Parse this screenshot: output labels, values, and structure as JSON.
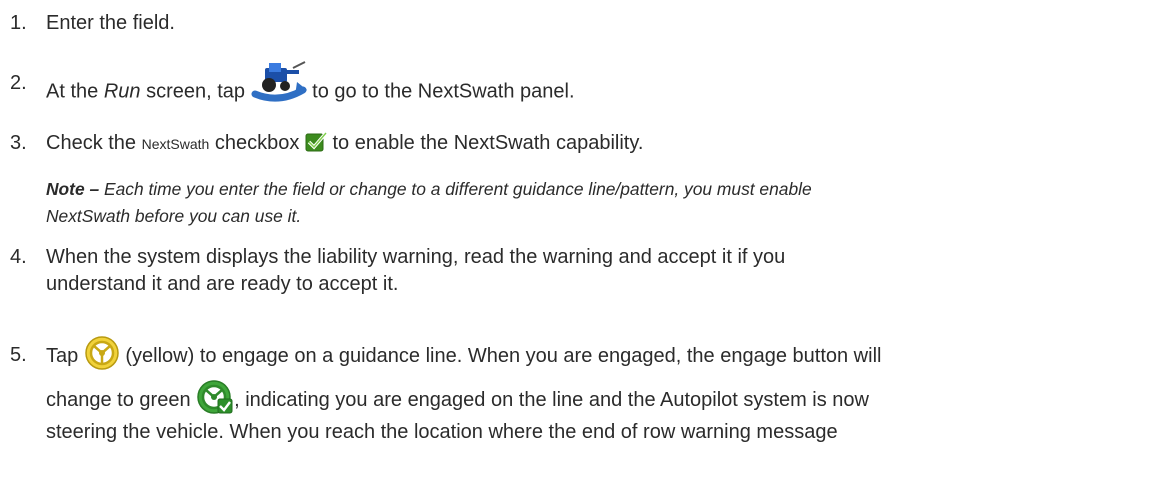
{
  "steps": [
    {
      "num": "1.",
      "text": "Enter the field."
    },
    {
      "num": "2.",
      "pre": "At the ",
      "screen": "Run",
      "mid": " screen, tap ",
      "post": " to go to the NextSwath panel.",
      "icon": "tractor-nextswath-icon"
    },
    {
      "num": "3.",
      "pre": "Check the ",
      "small": "NextSwath",
      "mid": " checkbox ",
      "post": " to enable the NextSwath capability.",
      "icon": "checkbox-checked-icon"
    },
    {
      "num": "4.",
      "line1": "When the system displays the liability warning, read the warning and accept it if you",
      "line2": "understand it and are ready to accept it."
    },
    {
      "num": "5.",
      "pre": "Tap ",
      "post": " (yellow) to engage on a guidance line. When you are engaged, the engage button will",
      "line2pre": "change to green ",
      "line2post": ", indicating you are engaged on the line and the Autopilot system is now",
      "line3": "steering the vehicle. When you reach the location where the end of row warning message",
      "icon1": "engage-yellow-icon",
      "icon2": "engage-green-icon"
    }
  ],
  "note": {
    "label": "Note –",
    "line1": " Each time you enter the field or change to a different guidance line/pattern, you must enable",
    "line2": "NextSwath before you can use it."
  }
}
